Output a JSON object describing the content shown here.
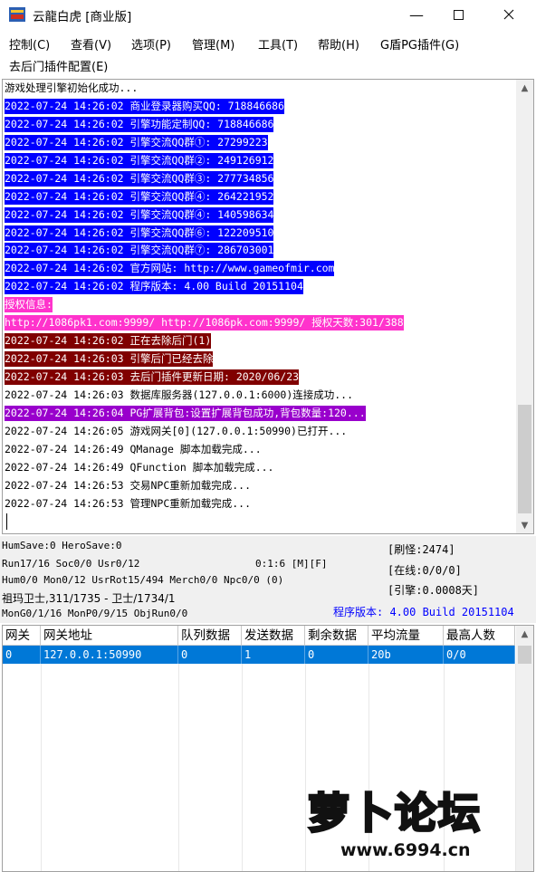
{
  "window": {
    "title": "云龍白虎 [商业版]"
  },
  "menu": {
    "items": [
      "控制(C)",
      "查看(V)",
      "选项(P)",
      "管理(M)",
      "工具(T)",
      "帮助(H)",
      "G盾PG插件(G)",
      "去后门插件配置(E)"
    ]
  },
  "log": {
    "lines": [
      {
        "text": "游戏处理引擎初始化成功...",
        "style": "none"
      },
      {
        "text": "2022-07-24 14:26:02 商业登录器购买QQ: 718846686",
        "style": "blue"
      },
      {
        "text": "2022-07-24 14:26:02 引擎功能定制QQ: 718846686",
        "style": "blue"
      },
      {
        "text": "2022-07-24 14:26:02 引擎交流QQ群①: 27299223",
        "style": "blue"
      },
      {
        "text": "2022-07-24 14:26:02 引擎交流QQ群②: 249126912",
        "style": "blue"
      },
      {
        "text": "2022-07-24 14:26:02 引擎交流QQ群③: 277734856",
        "style": "blue"
      },
      {
        "text": "2022-07-24 14:26:02 引擎交流QQ群④: 264221952",
        "style": "blue"
      },
      {
        "text": "2022-07-24 14:26:02 引擎交流QQ群④: 140598634",
        "style": "blue"
      },
      {
        "text": "2022-07-24 14:26:02 引擎交流QQ群⑥: 122209510",
        "style": "blue"
      },
      {
        "text": "2022-07-24 14:26:02 引擎交流QQ群⑦: 286703001",
        "style": "blue"
      },
      {
        "text": "2022-07-24 14:26:02 官方网站: http://www.gameofmir.com",
        "style": "blue"
      },
      {
        "text": "2022-07-24 14:26:02 程序版本: 4.00 Build 20151104",
        "style": "blue"
      },
      {
        "text": "授权信息:",
        "style": "magenta"
      },
      {
        "text": "http://1086pk1.com:9999/ http://1086pk.com:9999/ 授权天数:301/388",
        "style": "magenta"
      },
      {
        "text": "2022-07-24 14:26:02 正在去除后门(1)",
        "style": "maroon"
      },
      {
        "text": "2022-07-24 14:26:03 引擎后门已经去除",
        "style": "maroon"
      },
      {
        "text": "2022-07-24 14:26:03 去后门插件更新日期: 2020/06/23",
        "style": "maroon"
      },
      {
        "text": "2022-07-24 14:26:03 数据库服务器(127.0.0.1:6000)连接成功...",
        "style": "none"
      },
      {
        "text": "2022-07-24 14:26:04 PG扩展背包:设置扩展背包成功,背包数量:120...",
        "style": "purple"
      },
      {
        "text": "2022-07-24 14:26:05 游戏网关[0](127.0.0.1:50990)已打开...",
        "style": "none"
      },
      {
        "text": "2022-07-24 14:26:49 QManage 脚本加载完成...",
        "style": "none"
      },
      {
        "text": "2022-07-24 14:26:49 QFunction 脚本加载完成...",
        "style": "none"
      },
      {
        "text": "2022-07-24 14:26:53 交易NPC重新加载完成...",
        "style": "none"
      },
      {
        "text": "2022-07-24 14:26:53 管理NPC重新加载完成...",
        "style": "none"
      }
    ]
  },
  "status": {
    "hum_save": "HumSave:0 HeroSave:0",
    "run": "Run17/16 Soc0/0 Usr0/12",
    "timer": "0:1:6 [M][F]",
    "hum": "Hum0/0 Mon0/12 UsrRot15/494 Merch0/0 Npc0/0 (0)",
    "guard": "祖玛卫士,311/1735 - 卫士/1734/1",
    "mon": "MonG0/1/16 MonP0/9/15 ObjRun0/0",
    "refresh": "[刷怪:2474]",
    "online": "[在线:0/0/0]",
    "engine": "[引擎:0.0008天]",
    "version": "程序版本: 4.00 Build 20151104"
  },
  "table": {
    "columns": [
      "网关",
      "网关地址",
      "队列数据",
      "发送数据",
      "剩余数据",
      "平均流量",
      "最高人数"
    ],
    "rows": [
      [
        "0",
        "127.0.0.1:50990",
        "0",
        "1",
        "0",
        "20b",
        "0/0"
      ]
    ]
  },
  "watermark": {
    "text": "萝卜论坛",
    "url": "www.6994.cn"
  },
  "colors": {
    "blue_highlight": "#0000ff",
    "magenta_highlight": "#ff33cc",
    "maroon_highlight": "#800000",
    "purple_highlight": "#9900cc",
    "selection": "#0078d7"
  }
}
